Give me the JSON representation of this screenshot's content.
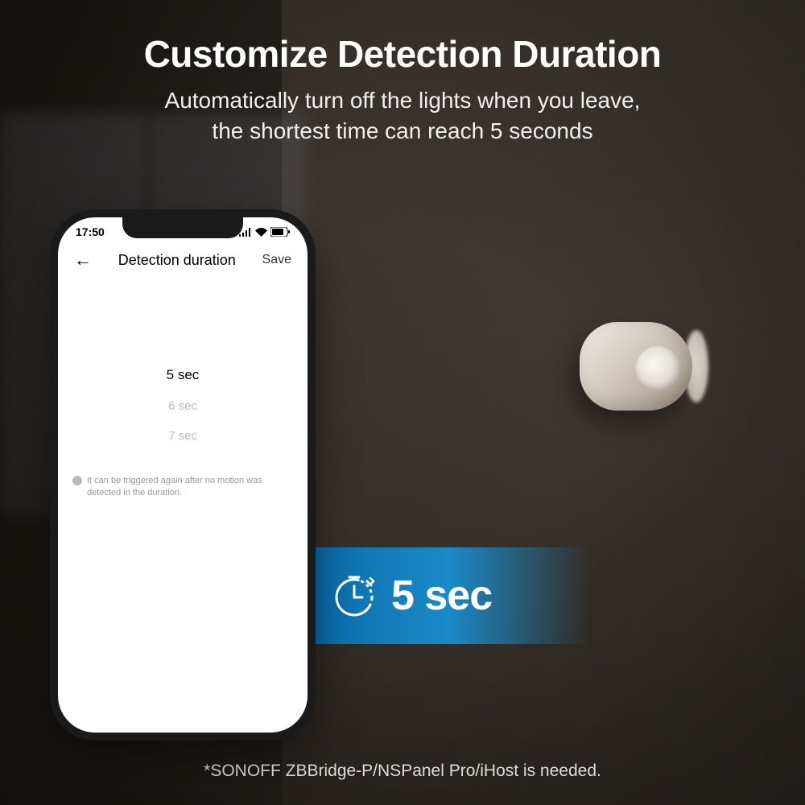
{
  "header": {
    "title": "Customize Detection Duration",
    "subtitle_line1": "Automatically turn off the lights when you leave,",
    "subtitle_line2": "the shortest time can reach 5 seconds"
  },
  "phone": {
    "status_time": "17:50",
    "nav_title": "Detection duration",
    "save_label": "Save",
    "picker": {
      "selected": "5 sec",
      "option_below_1": "6 sec",
      "option_below_2": "7 sec"
    },
    "help_text": "It can be triggered again after no motion was detected in the duration."
  },
  "callout": {
    "value": "5 sec"
  },
  "footer": {
    "note": "*SONOFF ZBBridge-P/NSPanel Pro/iHost is needed."
  }
}
